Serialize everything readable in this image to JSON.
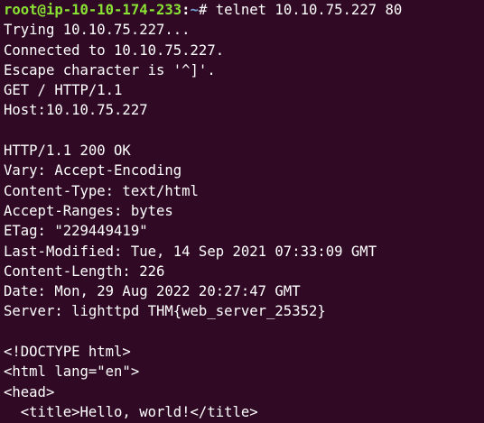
{
  "terminal": {
    "prompt": {
      "user_host": "root@ip-10-10-174-233",
      "colon": ":",
      "dir": "~",
      "symbol": "# ",
      "command": "telnet 10.10.75.227 80"
    },
    "lines": [
      "Trying 10.10.75.227...",
      "Connected to 10.10.75.227.",
      "Escape character is '^]'.",
      "GET / HTTP/1.1",
      "Host:10.10.75.227",
      "",
      "HTTP/1.1 200 OK",
      "Vary: Accept-Encoding",
      "Content-Type: text/html",
      "Accept-Ranges: bytes",
      "ETag: \"229449419\"",
      "Last-Modified: Tue, 14 Sep 2021 07:33:09 GMT",
      "Content-Length: 226",
      "Date: Mon, 29 Aug 2022 20:27:47 GMT",
      "Server: lighttpd THM{web_server_25352}",
      "",
      "<!DOCTYPE html>",
      "<html lang=\"en\">",
      "<head>",
      "  <title>Hello, world!</title>"
    ],
    "colors": {
      "background": "#300a24",
      "text": "#ffffff",
      "prompt_user": "#8ae234",
      "prompt_dir": "#729fcf"
    }
  }
}
